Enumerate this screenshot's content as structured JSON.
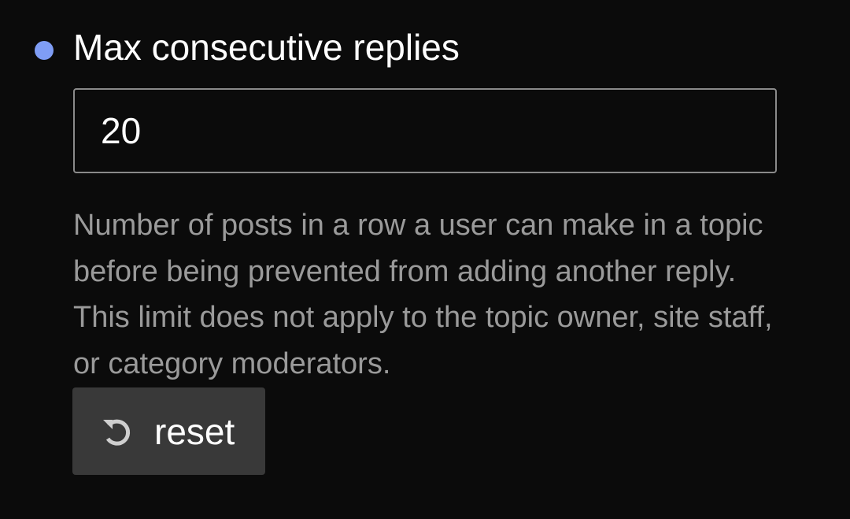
{
  "setting": {
    "title": "Max consecutive replies",
    "status_dot_color": "#7f9df5",
    "input_value": "20",
    "description": "Number of posts in a row a user can make in a topic before being prevented from adding another reply. This limit does not apply to the topic owner, site staff, or category moderators.",
    "reset_label": "reset",
    "reset_icon": "undo-icon"
  }
}
